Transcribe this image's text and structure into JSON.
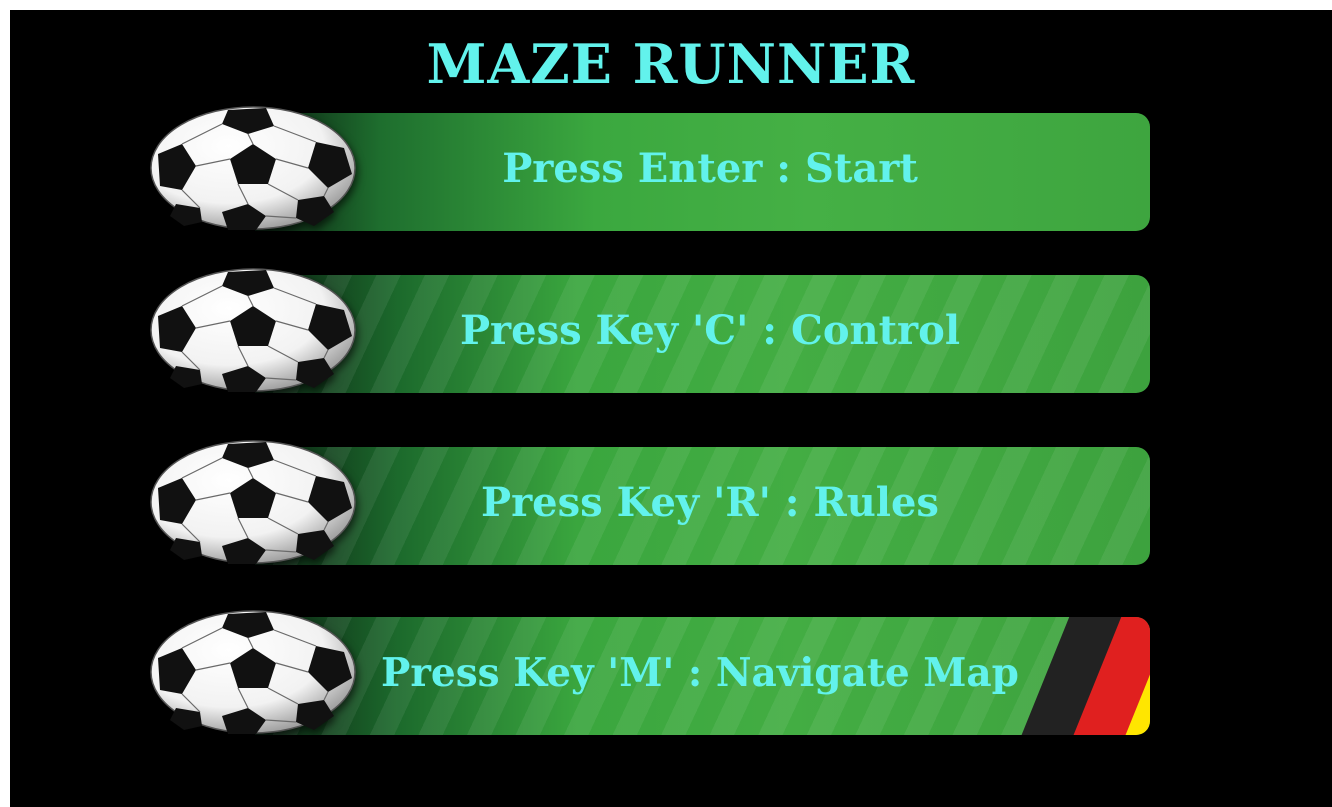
{
  "game": {
    "title": "MAZE RUNNER"
  },
  "menu": {
    "items": [
      {
        "label": "Press Enter : Start",
        "key": "Enter",
        "icon": "soccer-ball-icon"
      },
      {
        "label": "Press Key 'C' : Control",
        "key": "C",
        "icon": "soccer-ball-icon"
      },
      {
        "label": "Press Key 'R' : Rules",
        "key": "R",
        "icon": "soccer-ball-icon"
      },
      {
        "label": "Press Key 'M' : Navigate Map",
        "key": "M",
        "icon": "soccer-ball-icon"
      }
    ]
  },
  "colors": {
    "background": "#000000",
    "text": "#62f2ec",
    "bar_green": "#43ad43",
    "flag_black": "#222222",
    "flag_red": "#e0201f",
    "flag_yellow": "#ffe600"
  }
}
